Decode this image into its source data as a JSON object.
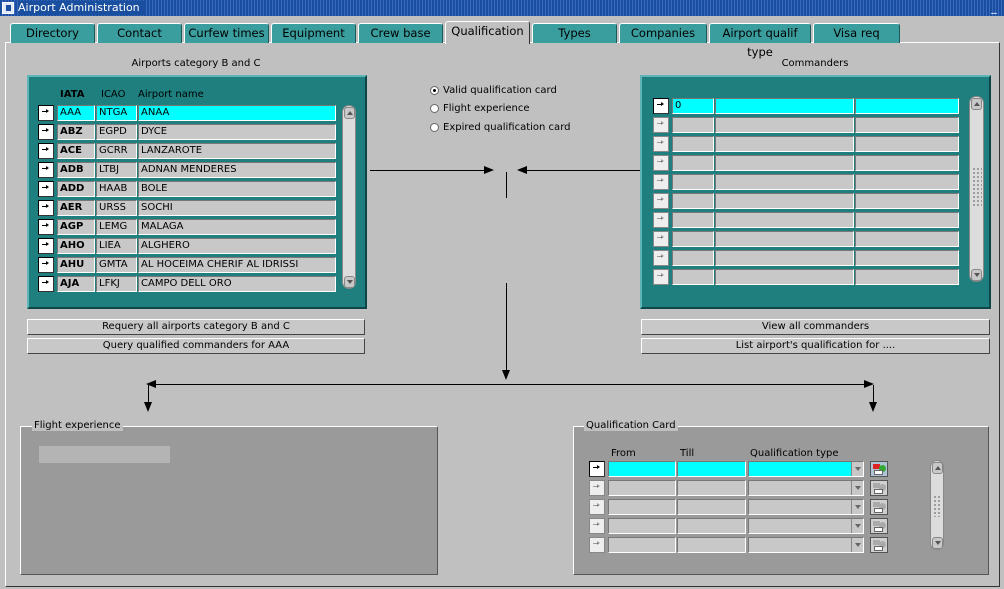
{
  "window": {
    "title": "Airport Administration",
    "minimize_glyph": "_"
  },
  "tabs": [
    {
      "label": "Directory"
    },
    {
      "label": "Contact"
    },
    {
      "label": "Curfew times"
    },
    {
      "label": "Equipment"
    },
    {
      "label": "Crew base"
    },
    {
      "label": "Qualification"
    },
    {
      "label": "Types"
    },
    {
      "label": "Companies"
    },
    {
      "label": "Airport qualif type"
    },
    {
      "label": "Visa req"
    }
  ],
  "active_tab": "Qualification",
  "airports": {
    "caption": "Airports category B and C",
    "headers": {
      "iata": "IATA",
      "icao": "ICAO",
      "name": "Airport name"
    },
    "rows": [
      {
        "iata": "AAA",
        "icao": "NTGA",
        "name": "ANAA"
      },
      {
        "iata": "ABZ",
        "icao": "EGPD",
        "name": "DYCE"
      },
      {
        "iata": "ACE",
        "icao": "GCRR",
        "name": "LANZAROTE"
      },
      {
        "iata": "ADB",
        "icao": "LTBJ",
        "name": "ADNAN MENDERES"
      },
      {
        "iata": "ADD",
        "icao": "HAAB",
        "name": "BOLE"
      },
      {
        "iata": "AER",
        "icao": "URSS",
        "name": "SOCHI"
      },
      {
        "iata": "AGP",
        "icao": "LEMG",
        "name": "MALAGA"
      },
      {
        "iata": "AHO",
        "icao": "LIEA",
        "name": "ALGHERO"
      },
      {
        "iata": "AHU",
        "icao": "GMTA",
        "name": "AL HOCEIMA CHERIF AL IDRISSI"
      },
      {
        "iata": "AJA",
        "icao": "LFKJ",
        "name": "CAMPO DELL ORO"
      }
    ],
    "requery_button": "Requery all airports category B and C",
    "query_button": "Query qualified commanders for AAA"
  },
  "options": {
    "selected": "Valid qualification card",
    "items": [
      {
        "label": "Valid qualification card"
      },
      {
        "label": "Flight experience"
      },
      {
        "label": "Expired qualification card"
      }
    ]
  },
  "commanders": {
    "caption": "Commanders",
    "first_value": "0",
    "view_button": "View all commanders",
    "list_button": "List airport's qualification for ...."
  },
  "flight_experience": {
    "label": "Flight experience"
  },
  "qualification_card": {
    "label": "Qualification Card",
    "headers": {
      "from": "From",
      "till": "Till",
      "type": "Qualification type"
    }
  },
  "colors": {
    "teal": "#1f7f7f",
    "highlight": "#00ffff",
    "titlebar": "#1a4fa0",
    "tab": "#3b9e9e"
  }
}
